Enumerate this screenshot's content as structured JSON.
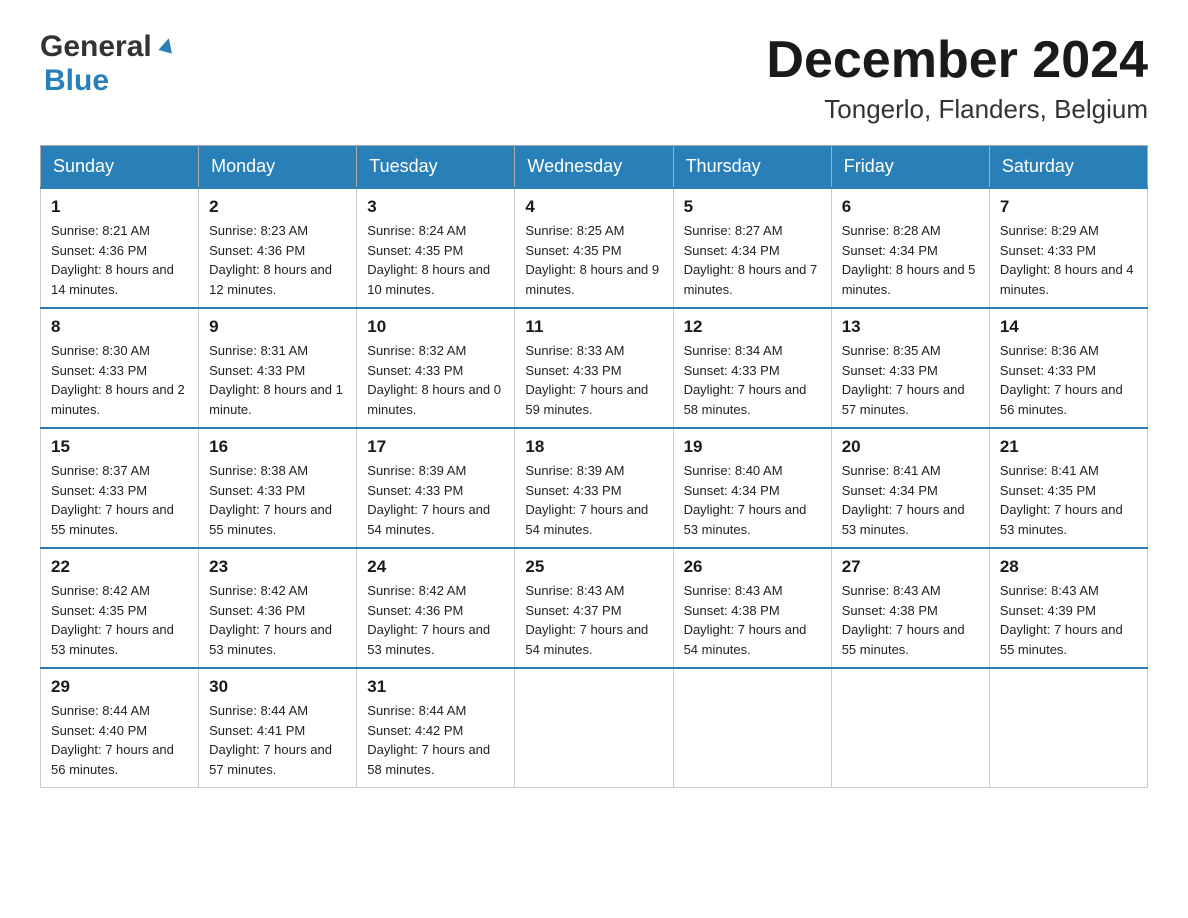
{
  "logo": {
    "general": "General",
    "blue": "Blue"
  },
  "title": "December 2024",
  "subtitle": "Tongerlo, Flanders, Belgium",
  "days_of_week": [
    "Sunday",
    "Monday",
    "Tuesday",
    "Wednesday",
    "Thursday",
    "Friday",
    "Saturday"
  ],
  "weeks": [
    [
      {
        "day": "1",
        "sunrise": "8:21 AM",
        "sunset": "4:36 PM",
        "daylight": "8 hours and 14 minutes."
      },
      {
        "day": "2",
        "sunrise": "8:23 AM",
        "sunset": "4:36 PM",
        "daylight": "8 hours and 12 minutes."
      },
      {
        "day": "3",
        "sunrise": "8:24 AM",
        "sunset": "4:35 PM",
        "daylight": "8 hours and 10 minutes."
      },
      {
        "day": "4",
        "sunrise": "8:25 AM",
        "sunset": "4:35 PM",
        "daylight": "8 hours and 9 minutes."
      },
      {
        "day": "5",
        "sunrise": "8:27 AM",
        "sunset": "4:34 PM",
        "daylight": "8 hours and 7 minutes."
      },
      {
        "day": "6",
        "sunrise": "8:28 AM",
        "sunset": "4:34 PM",
        "daylight": "8 hours and 5 minutes."
      },
      {
        "day": "7",
        "sunrise": "8:29 AM",
        "sunset": "4:33 PM",
        "daylight": "8 hours and 4 minutes."
      }
    ],
    [
      {
        "day": "8",
        "sunrise": "8:30 AM",
        "sunset": "4:33 PM",
        "daylight": "8 hours and 2 minutes."
      },
      {
        "day": "9",
        "sunrise": "8:31 AM",
        "sunset": "4:33 PM",
        "daylight": "8 hours and 1 minute."
      },
      {
        "day": "10",
        "sunrise": "8:32 AM",
        "sunset": "4:33 PM",
        "daylight": "8 hours and 0 minutes."
      },
      {
        "day": "11",
        "sunrise": "8:33 AM",
        "sunset": "4:33 PM",
        "daylight": "7 hours and 59 minutes."
      },
      {
        "day": "12",
        "sunrise": "8:34 AM",
        "sunset": "4:33 PM",
        "daylight": "7 hours and 58 minutes."
      },
      {
        "day": "13",
        "sunrise": "8:35 AM",
        "sunset": "4:33 PM",
        "daylight": "7 hours and 57 minutes."
      },
      {
        "day": "14",
        "sunrise": "8:36 AM",
        "sunset": "4:33 PM",
        "daylight": "7 hours and 56 minutes."
      }
    ],
    [
      {
        "day": "15",
        "sunrise": "8:37 AM",
        "sunset": "4:33 PM",
        "daylight": "7 hours and 55 minutes."
      },
      {
        "day": "16",
        "sunrise": "8:38 AM",
        "sunset": "4:33 PM",
        "daylight": "7 hours and 55 minutes."
      },
      {
        "day": "17",
        "sunrise": "8:39 AM",
        "sunset": "4:33 PM",
        "daylight": "7 hours and 54 minutes."
      },
      {
        "day": "18",
        "sunrise": "8:39 AM",
        "sunset": "4:33 PM",
        "daylight": "7 hours and 54 minutes."
      },
      {
        "day": "19",
        "sunrise": "8:40 AM",
        "sunset": "4:34 PM",
        "daylight": "7 hours and 53 minutes."
      },
      {
        "day": "20",
        "sunrise": "8:41 AM",
        "sunset": "4:34 PM",
        "daylight": "7 hours and 53 minutes."
      },
      {
        "day": "21",
        "sunrise": "8:41 AM",
        "sunset": "4:35 PM",
        "daylight": "7 hours and 53 minutes."
      }
    ],
    [
      {
        "day": "22",
        "sunrise": "8:42 AM",
        "sunset": "4:35 PM",
        "daylight": "7 hours and 53 minutes."
      },
      {
        "day": "23",
        "sunrise": "8:42 AM",
        "sunset": "4:36 PM",
        "daylight": "7 hours and 53 minutes."
      },
      {
        "day": "24",
        "sunrise": "8:42 AM",
        "sunset": "4:36 PM",
        "daylight": "7 hours and 53 minutes."
      },
      {
        "day": "25",
        "sunrise": "8:43 AM",
        "sunset": "4:37 PM",
        "daylight": "7 hours and 54 minutes."
      },
      {
        "day": "26",
        "sunrise": "8:43 AM",
        "sunset": "4:38 PM",
        "daylight": "7 hours and 54 minutes."
      },
      {
        "day": "27",
        "sunrise": "8:43 AM",
        "sunset": "4:38 PM",
        "daylight": "7 hours and 55 minutes."
      },
      {
        "day": "28",
        "sunrise": "8:43 AM",
        "sunset": "4:39 PM",
        "daylight": "7 hours and 55 minutes."
      }
    ],
    [
      {
        "day": "29",
        "sunrise": "8:44 AM",
        "sunset": "4:40 PM",
        "daylight": "7 hours and 56 minutes."
      },
      {
        "day": "30",
        "sunrise": "8:44 AM",
        "sunset": "4:41 PM",
        "daylight": "7 hours and 57 minutes."
      },
      {
        "day": "31",
        "sunrise": "8:44 AM",
        "sunset": "4:42 PM",
        "daylight": "7 hours and 58 minutes."
      },
      null,
      null,
      null,
      null
    ]
  ]
}
